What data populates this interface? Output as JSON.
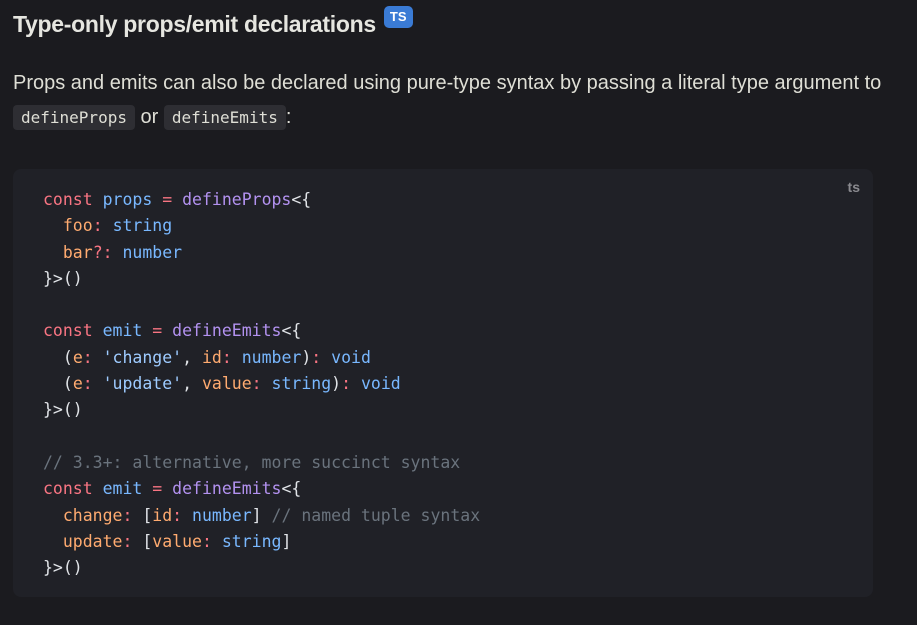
{
  "heading": {
    "title": "Type-only props/emit declarations",
    "badge": "TS"
  },
  "paragraph": {
    "text_before": "Props and emits can also be declared using pure-type syntax by passing a literal type argument to ",
    "code1": "defineProps",
    "middle": " or ",
    "code2": "defineEmits",
    "text_after": ":"
  },
  "code_block": {
    "lang": "ts",
    "tokens": {
      "const": "const",
      "props": "props",
      "emit": "emit",
      "eq": " = ",
      "defineProps": "defineProps",
      "defineEmits": "defineEmits",
      "open": "<{",
      "close": "}>()",
      "foo": "foo",
      "bar": "bar",
      "string": "string",
      "number": "number",
      "void": "void",
      "e": "e",
      "id": "id",
      "value": "value",
      "change_str": "'change'",
      "update_str": "'update'",
      "change": "change",
      "update": "update",
      "comment1": "// 3.3+: alternative, more succinct syntax",
      "comment2": "// named tuple syntax"
    }
  }
}
